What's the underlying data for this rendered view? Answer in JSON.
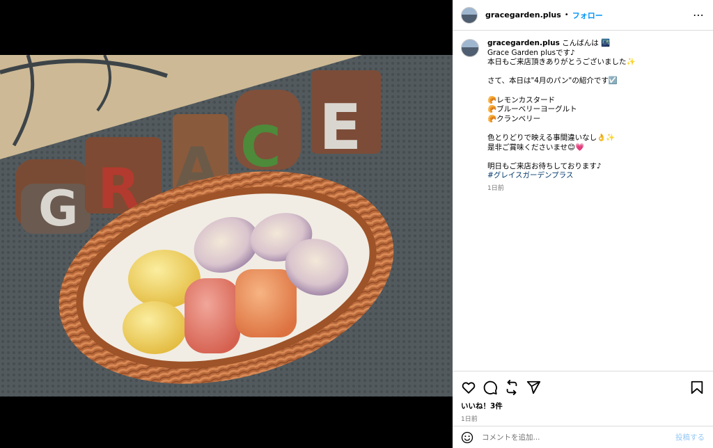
{
  "post": {
    "username": "gracegarden.plus",
    "separator": "•",
    "follow_label": "フォロー",
    "more_icon": "more-horizontal-icon"
  },
  "photo": {
    "block_letters": [
      "G",
      "R",
      "A",
      "C",
      "E"
    ],
    "block_colors": [
      "#d9d6cf",
      "#b33a2e",
      "#6b5a48",
      "#4d8a3a",
      "#d9d6cf"
    ]
  },
  "caption": {
    "username": "gracegarden.plus",
    "lines": [
      "こんばんは 🌃",
      "Grace Garden plusです♪",
      "本日もご来店頂きありがとうございました✨",
      "",
      "さて、本日は\"4月のパン\"の紹介です☑️",
      "",
      "🥐レモンカスタード",
      "🥐ブルーベリーヨーグルト",
      "🥐クランベリー",
      "",
      "色とりどりで映える事間違いなし👌✨",
      "是非ご賞味くださいませ😊💗",
      "",
      "明日もご来店お待ちしております♪"
    ],
    "hashtag": "#グレイスガーデンプラス",
    "time": "1日前"
  },
  "actions": {
    "icons": [
      "heart-icon",
      "comment-icon",
      "repost-icon",
      "share-icon",
      "bookmark-icon"
    ],
    "likes": "いいね！3件",
    "posted": "1日前"
  },
  "comment": {
    "placeholder": "コメントを追加...",
    "post_label": "投稿する"
  }
}
